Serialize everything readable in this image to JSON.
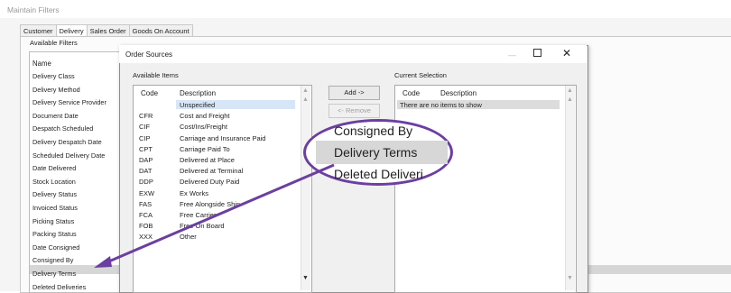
{
  "window": {
    "title": "Maintain Filters"
  },
  "tabs": [
    {
      "label": "Customer"
    },
    {
      "label": "Delivery"
    },
    {
      "label": "Sales Order"
    },
    {
      "label": "Goods On Account"
    }
  ],
  "available_filters": {
    "label": "Available Filters",
    "header": "Name",
    "items": [
      "Delivery Class",
      "Delivery Method",
      "Delivery Service Provider",
      "Document Date",
      "Despatch Scheduled",
      "Delivery Despatch Date",
      "Scheduled Delivery Date",
      "Date Delivered",
      "Stock Location",
      "Delivery Status",
      "Invoiced Status",
      "Picking Status",
      "Packing Status",
      "Date Consigned",
      "Consigned By",
      "Delivery Terms",
      "Deleted Deliveries"
    ],
    "selected": "Delivery Terms"
  },
  "dialog": {
    "title": "Order Sources",
    "minimize": "—",
    "close": "✕",
    "available_items_label": "Available Items",
    "current_selection_label": "Current Selection",
    "add_button": "Add ->",
    "remove_button": "<- Remove",
    "columns": {
      "code": "Code",
      "description": "Description"
    },
    "items": [
      {
        "code": "",
        "description": "Unspecified"
      },
      {
        "code": "CFR",
        "description": "Cost and Freight"
      },
      {
        "code": "CIF",
        "description": "Cost/Ins/Freight"
      },
      {
        "code": "CIP",
        "description": "Carriage and Insurance Paid"
      },
      {
        "code": "CPT",
        "description": "Carriage Paid To"
      },
      {
        "code": "DAP",
        "description": "Delivered at Place"
      },
      {
        "code": "DAT",
        "description": "Delivered at Terminal"
      },
      {
        "code": "DDP",
        "description": "Delivered Duty Paid"
      },
      {
        "code": "EXW",
        "description": "Ex Works"
      },
      {
        "code": "FAS",
        "description": "Free Alongside Ship"
      },
      {
        "code": "FCA",
        "description": "Free Carrier"
      },
      {
        "code": "FOB",
        "description": "Free On Board"
      },
      {
        "code": "XXX",
        "description": "Other"
      }
    ],
    "current_selection_empty": "There are no items to show"
  },
  "callout": {
    "lines": [
      "Consigned By",
      "Delivery Terms",
      "Deleted Deliveri"
    ],
    "highlighted": "Delivery Terms",
    "color": "#6b3fa0"
  }
}
